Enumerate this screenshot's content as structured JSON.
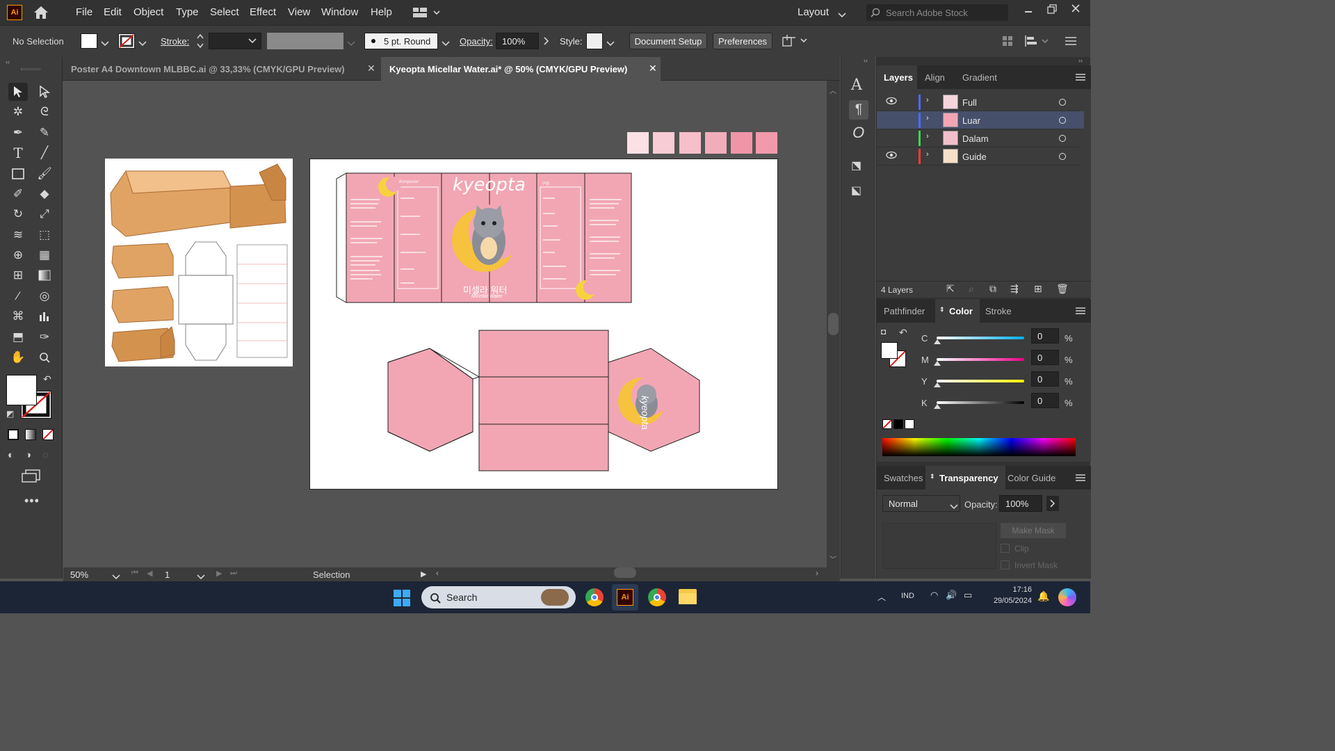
{
  "app": {
    "logo": "Ai"
  },
  "menus": [
    "File",
    "Edit",
    "Object",
    "Type",
    "Select",
    "Effect",
    "View",
    "Window",
    "Help"
  ],
  "workspace": {
    "label": "Layout",
    "search_placeholder": "Search Adobe Stock"
  },
  "control_bar": {
    "selection": "No Selection",
    "stroke_label": "Stroke:",
    "brush": "5 pt. Round",
    "opacity_label": "Opacity:",
    "opacity_value": "100%",
    "style_label": "Style:",
    "document_setup": "Document Setup",
    "preferences": "Preferences"
  },
  "tabs": [
    {
      "label": "Poster A4 Downtown MLBBC.ai @ 33,33% (CMYK/GPU Preview)",
      "active": false
    },
    {
      "label": "Kyeopta Micellar Water.ai* @ 50% (CMYK/GPU Preview)",
      "active": true
    }
  ],
  "status": {
    "zoom": "50%",
    "artboard": "1",
    "tool": "Selection"
  },
  "layers_panel": {
    "tabs": [
      "Layers",
      "Align",
      "Gradient"
    ],
    "layers": [
      {
        "name": "Full",
        "color": "#4f6bff",
        "visible": true
      },
      {
        "name": "Luar",
        "color": "#4f6bff",
        "visible": false
      },
      {
        "name": "Dalam",
        "color": "#3adb4a",
        "visible": false
      },
      {
        "name": "Guide",
        "color": "#ff3b3b",
        "visible": true
      }
    ],
    "count": "4 Layers"
  },
  "color_panel": {
    "tabs": [
      "Pathfinder",
      "Color",
      "Stroke"
    ],
    "channels": [
      {
        "label": "C",
        "value": "0",
        "unit": "%"
      },
      {
        "label": "M",
        "value": "0",
        "unit": "%"
      },
      {
        "label": "Y",
        "value": "0",
        "unit": "%"
      },
      {
        "label": "K",
        "value": "0",
        "unit": "%"
      }
    ]
  },
  "transparency_panel": {
    "tabs": [
      "Swatches",
      "Transparency",
      "Color Guide"
    ],
    "blend_mode": "Normal",
    "opacity_label": "Opacity:",
    "opacity_value": "100%",
    "make_mask": "Make Mask",
    "clip": "Clip",
    "invert_mask": "Invert Mask"
  },
  "artwork": {
    "brand": "kyeopta",
    "korean_title": "미셀라 워터",
    "subtitle": "Micellar Water",
    "komposisi": "Komposisi",
    "korean_composition": "구성",
    "swatch_colors": [
      "#fbe1e6",
      "#f8ccd4",
      "#f6bfca",
      "#f2adbb",
      "#f095a8",
      "#f29aab"
    ]
  },
  "taskbar": {
    "search": "Search",
    "language": "IND",
    "time": "17:16",
    "date": "29/05/2024"
  }
}
